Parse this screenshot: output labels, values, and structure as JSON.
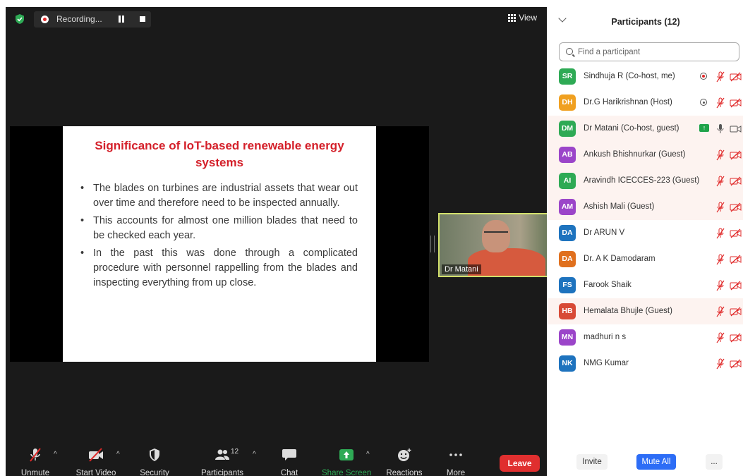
{
  "meeting": {
    "recording_label": "Recording...",
    "view_label": "View",
    "slide": {
      "title": "Significance of IoT-based renewable energy systems",
      "bullets": [
        "The blades on turbines are industrial assets that wear out over time and therefore need to be inspected annually.",
        "This accounts for almost one million blades that need to be checked each year.",
        "In the past this was done through a complicated procedure with personnel rappelling from the blades and inspecting everything from up close."
      ]
    },
    "video_tile_name": "Dr Matani",
    "toolbar": {
      "unmute": "Unmute",
      "start_video": "Start Video",
      "security": "Security",
      "participants": "Participants",
      "participants_count": "12",
      "chat": "Chat",
      "share_screen": "Share Screen",
      "reactions": "Reactions",
      "more": "More",
      "leave": "Leave"
    }
  },
  "panel": {
    "title": "Participants (12)",
    "search_placeholder": "Find a participant",
    "participants": [
      {
        "initials": "SR",
        "name": "Sindhuja R (Co-host, me)",
        "color": "#2eaa55"
      },
      {
        "initials": "DH",
        "name": "Dr.G Harikrishnan (Host)",
        "color": "#f0a020"
      },
      {
        "initials": "DM",
        "name": "Dr Matani (Co-host, guest)",
        "color": "#2eaa55"
      },
      {
        "initials": "AB",
        "name": "Ankush Bhishnurkar (Guest)",
        "color": "#9b45c9"
      },
      {
        "initials": "AI",
        "name": "Aravindh  ICECCES-223 (Guest)",
        "color": "#2eaa55"
      },
      {
        "initials": "AM",
        "name": "Ashish Mali (Guest)",
        "color": "#9b45c9"
      },
      {
        "initials": "DA",
        "name": "Dr ARUN V",
        "color": "#1e73be"
      },
      {
        "initials": "DA",
        "name": "Dr. A K Damodaram",
        "color": "#e0701e"
      },
      {
        "initials": "FS",
        "name": "Farook Shaik",
        "color": "#1e73be"
      },
      {
        "initials": "HB",
        "name": "Hemalata Bhujle (Guest)",
        "color": "#d84a36"
      },
      {
        "initials": "MN",
        "name": "madhuri n s",
        "color": "#9b45c9"
      },
      {
        "initials": "NK",
        "name": "NMG Kumar",
        "color": "#1e73be"
      }
    ],
    "footer": {
      "invite": "Invite",
      "mute_all": "Mute All",
      "more": "..."
    }
  }
}
